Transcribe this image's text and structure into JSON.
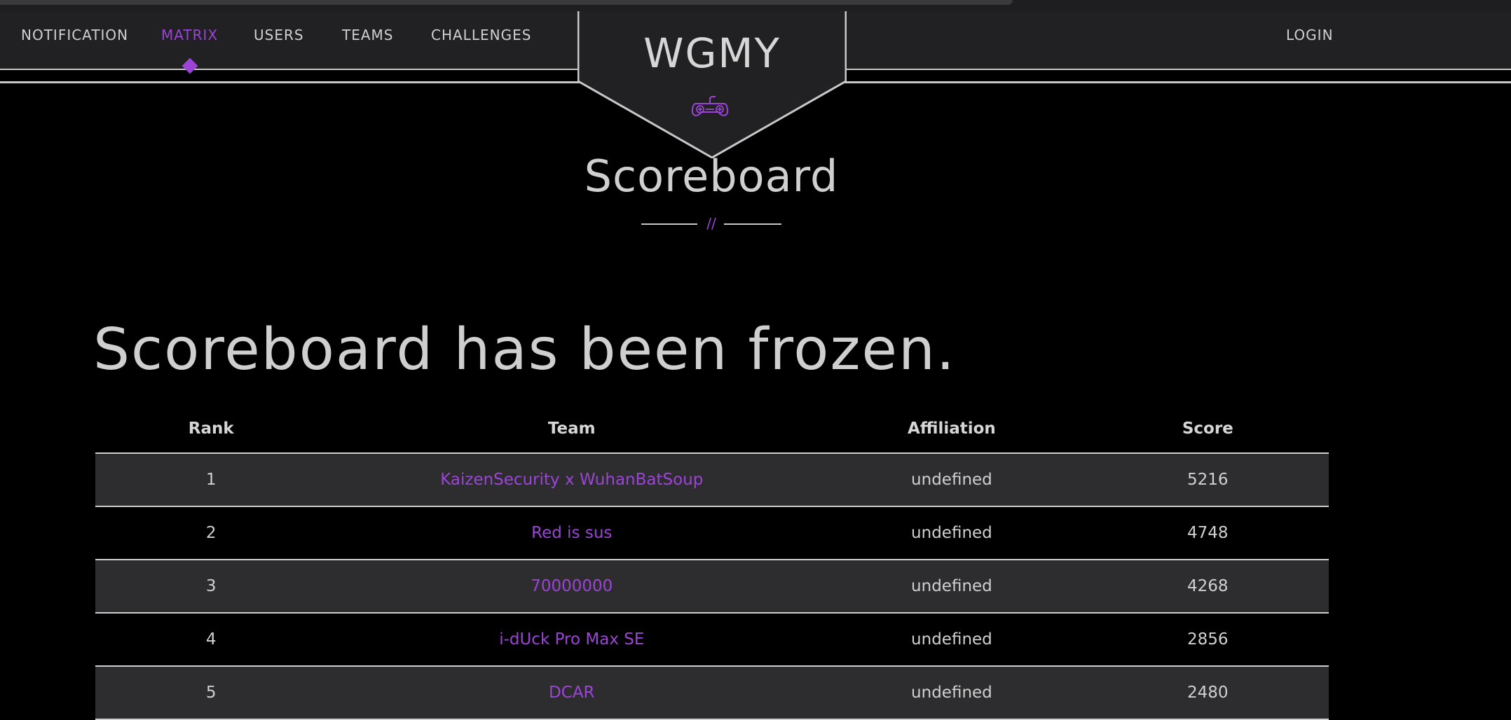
{
  "nav": {
    "items": [
      {
        "label": "NOTIFICATION"
      },
      {
        "label": "MATRIX"
      },
      {
        "label": "USERS"
      },
      {
        "label": "TEAMS"
      },
      {
        "label": "CHALLENGES"
      }
    ],
    "active": "MATRIX",
    "login_label": "LOGIN"
  },
  "brand": {
    "logo_text": "WGMY",
    "icon": "gamepad-icon"
  },
  "page": {
    "title": "Scoreboard",
    "separator_text": "//",
    "frozen_message": "Scoreboard has been frozen."
  },
  "table": {
    "headers": {
      "rank": "Rank",
      "team": "Team",
      "affiliation": "Affiliation",
      "score": "Score"
    },
    "rows": [
      {
        "rank": "1",
        "team": "KaizenSecurity x WuhanBatSoup",
        "affiliation": "undefined",
        "score": "5216"
      },
      {
        "rank": "2",
        "team": "Red is sus",
        "affiliation": "undefined",
        "score": "4748"
      },
      {
        "rank": "3",
        "team": "70000000",
        "affiliation": "undefined",
        "score": "4268"
      },
      {
        "rank": "4",
        "team": "i-dUck Pro Max SE",
        "affiliation": "undefined",
        "score": "2856"
      },
      {
        "rank": "5",
        "team": "DCAR",
        "affiliation": "undefined",
        "score": "2480"
      }
    ]
  },
  "colors": {
    "accent": "#9b44d6",
    "navbar_bg": "#212123",
    "row_alt_bg": "#2d2d2f",
    "text": "#cfcfcf"
  }
}
